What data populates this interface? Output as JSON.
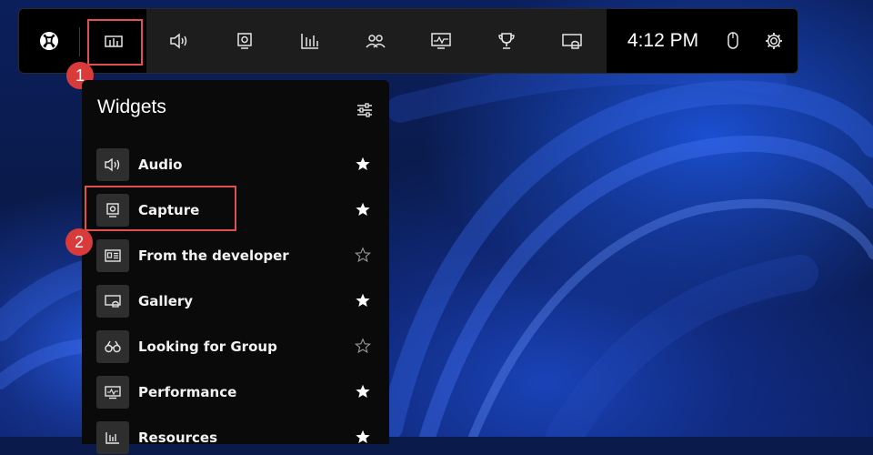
{
  "gamebar": {
    "clock": "4:12 PM",
    "buttons": [
      {
        "name": "xbox-icon"
      },
      {
        "name": "widget-menu-icon"
      },
      {
        "name": "audio-icon"
      },
      {
        "name": "capture-icon"
      },
      {
        "name": "performance-bars-icon"
      },
      {
        "name": "social-icon"
      },
      {
        "name": "performance-monitor-icon"
      },
      {
        "name": "achievements-trophy-icon"
      },
      {
        "name": "gallery-icon"
      },
      {
        "name": "mouse-icon"
      },
      {
        "name": "settings-gear-icon"
      }
    ]
  },
  "panel": {
    "title": "Widgets",
    "items": [
      {
        "label": "Audio",
        "icon": "speaker-icon",
        "favorite": true
      },
      {
        "label": "Capture",
        "icon": "capture-icon",
        "favorite": true
      },
      {
        "label": "From the developer",
        "icon": "developer-icon",
        "favorite": false
      },
      {
        "label": "Gallery",
        "icon": "gallery-icon",
        "favorite": true
      },
      {
        "label": "Looking for Group",
        "icon": "binoculars-icon",
        "favorite": false
      },
      {
        "label": "Performance",
        "icon": "performance-monitor-icon",
        "favorite": true
      },
      {
        "label": "Resources",
        "icon": "resources-bars-icon",
        "favorite": true
      }
    ]
  },
  "annotations": {
    "step1": "1",
    "step2": "2"
  },
  "colors": {
    "highlight": "#e05050",
    "badge": "#d93a3a",
    "bar_bg": "#000000",
    "bar_main_bg": "#1d1d1d"
  }
}
